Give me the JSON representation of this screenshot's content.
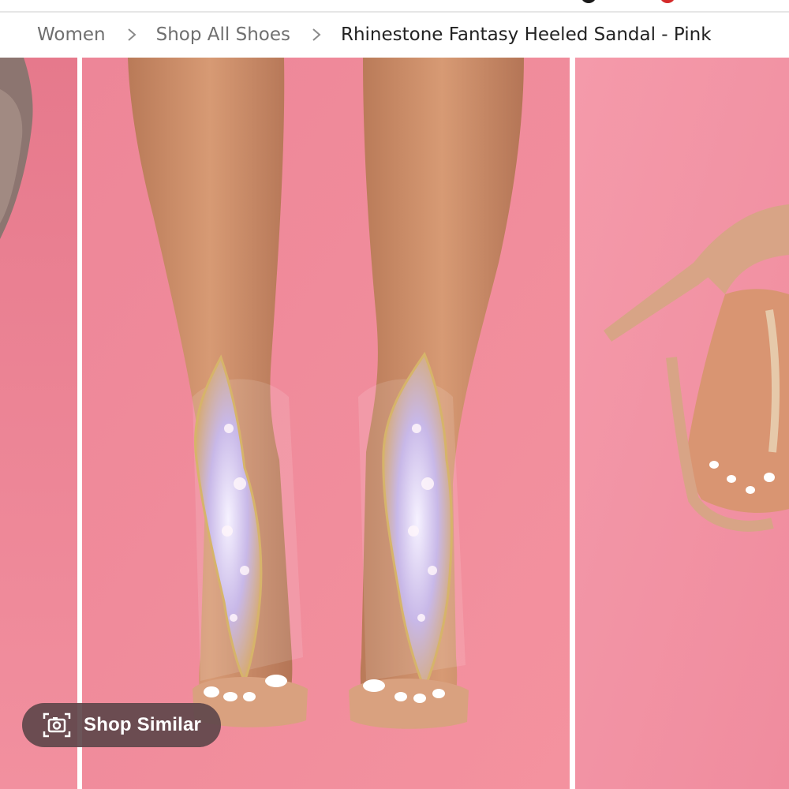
{
  "breadcrumb": {
    "items": [
      "Women",
      "Shop All Shoes"
    ],
    "current": "Rhinestone Fantasy Heeled Sandal - Pink",
    "separator_icon": "chevron-right-icon"
  },
  "gallery": {
    "background_color": "#f0899b",
    "images": [
      {
        "name": "previous-product-image",
        "subject": "taupe suede shoe (partial)"
      },
      {
        "name": "front-view-image",
        "subject": "rhinestone heeled sandals front view"
      },
      {
        "name": "side-view-image",
        "subject": "rhinestone heeled sandal side view (partial)"
      }
    ]
  },
  "shop_similar": {
    "label": "Shop Similar",
    "icon": "camera-icon"
  },
  "colors": {
    "breadcrumb_text": "#6f6f6f",
    "breadcrumb_current": "#222222",
    "pill_background": "#60464b"
  }
}
